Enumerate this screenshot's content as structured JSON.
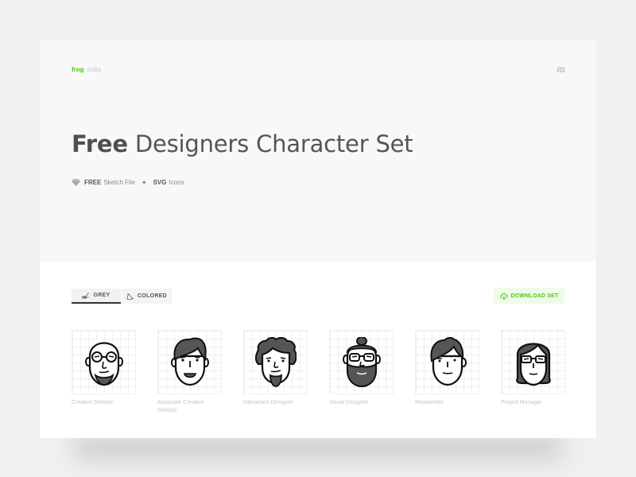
{
  "brand": {
    "name": "frog",
    "region": "India",
    "partner_logo": "R3",
    "accent_color": "#4ec30a"
  },
  "hero": {
    "title_bold": "Free",
    "title_rest": "Designers Character Set",
    "sub": {
      "icon": "sketch-diamond-icon",
      "free_bold": "FREE",
      "free_text": "Sketch File",
      "plus": "+",
      "svg_bold": "SVG",
      "svg_text": "Icons"
    }
  },
  "toolbar": {
    "tabs": [
      {
        "label": "GREY",
        "icon": "grey-brush-icon",
        "active": true
      },
      {
        "label": "COLORED",
        "icon": "paint-bucket-icon",
        "active": false
      }
    ],
    "download_label": "DOWNLOAD SET",
    "download_icon": "cloud-download-icon",
    "download_color": "#53c51b"
  },
  "characters": [
    {
      "name": "Creative Director",
      "icon": "bald-glasses-goatee-avatar"
    },
    {
      "name": "Associate Creative Director",
      "icon": "short-hair-open-mouth-avatar"
    },
    {
      "name": "Interaction Designer",
      "icon": "curly-hair-beard-avatar"
    },
    {
      "name": "Visual Designer",
      "icon": "topknot-glasses-full-beard-avatar"
    },
    {
      "name": "Researcher",
      "icon": "side-fringe-avatar"
    },
    {
      "name": "Project Manager",
      "icon": "long-hair-glasses-woman-avatar"
    }
  ]
}
